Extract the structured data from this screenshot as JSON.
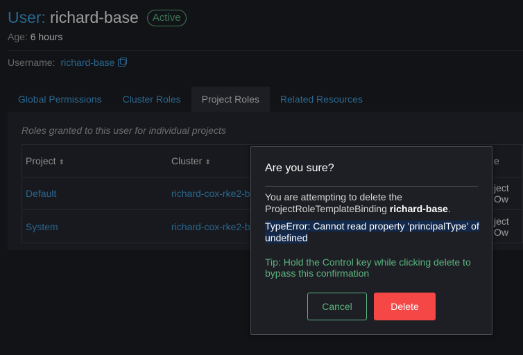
{
  "header": {
    "title_prefix": "User:",
    "title_name": "richard-base",
    "status": "Active",
    "age_label": "Age:",
    "age_value": "6 hours",
    "username_label": "Username:",
    "username_value": "richard-base"
  },
  "tabs": [
    {
      "label": "Global Permissions",
      "active": false
    },
    {
      "label": "Cluster Roles",
      "active": false
    },
    {
      "label": "Project Roles",
      "active": true
    },
    {
      "label": "Related Resources",
      "active": false
    }
  ],
  "panel": {
    "description": "Roles granted to this user for individual projects",
    "columns": [
      "Project",
      "Cluster",
      "e"
    ],
    "rows": [
      {
        "project": "Default",
        "cluster": "richard-cox-rke2-b",
        "role": "ject Ow"
      },
      {
        "project": "System",
        "cluster": "richard-cox-rke2-b",
        "role": "ject Ow"
      }
    ]
  },
  "modal": {
    "title": "Are you sure?",
    "message_prefix": "You are attempting to delete the ProjectRoleTemplateBinding ",
    "message_name": "richard-base",
    "message_suffix": ".",
    "error": "TypeError: Cannot read property 'principalType' of undefined",
    "tip": "Tip: Hold the Control key while clicking delete to bypass this confirmation",
    "cancel_label": "Cancel",
    "delete_label": "Delete"
  },
  "colors": {
    "accent_blue": "#3d98d3",
    "success_green": "#5bb37f",
    "danger_red": "#f64747"
  }
}
